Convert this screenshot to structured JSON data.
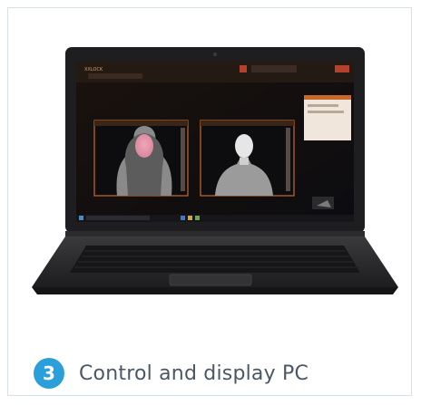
{
  "figure": {
    "step_number": "3",
    "caption": "Control and display PC",
    "screen_app_name": "XXLOCK"
  },
  "colors": {
    "badge": "#2a9fd9",
    "caption_text": "#4a5866",
    "card_border": "#d7dfe7",
    "laptop_body": "#2b2b2d",
    "screen_ui_accent": "#c8692c"
  }
}
